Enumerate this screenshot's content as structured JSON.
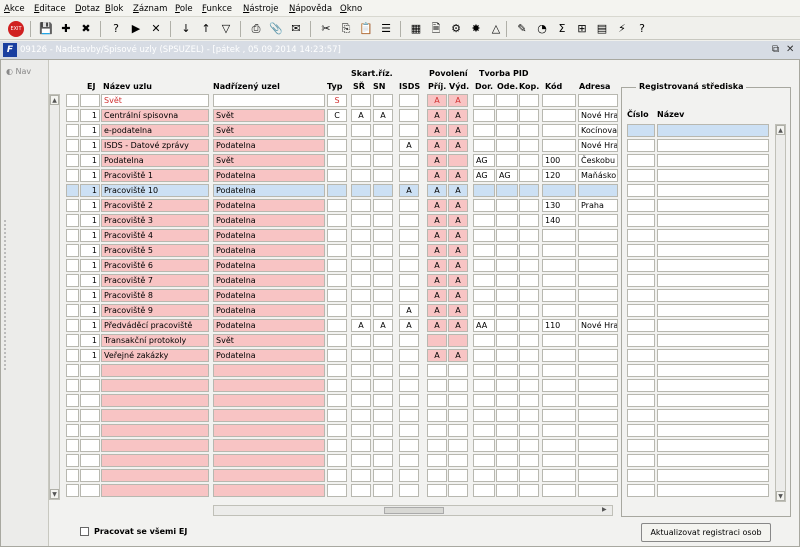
{
  "menu": [
    "Akce",
    "Editace",
    "Dotaz",
    "Blok",
    "Záznam",
    "Pole",
    "Funkce",
    "Nástroje",
    "Nápověda",
    "Okno"
  ],
  "toolbar": {
    "exit_label": "EXIT",
    "icons": [
      "exit-icon",
      "save-icon",
      "new-record-icon",
      "delete-record-icon",
      "enter-query-icon",
      "execute-query-icon",
      "cancel-query-icon",
      "sort-asc-icon",
      "sort-desc-icon",
      "filter-icon",
      "print-icon",
      "attach-icon",
      "mail-icon",
      "cut-icon",
      "copy-icon",
      "paste-icon",
      "list-icon",
      "calculator-icon",
      "document-icon",
      "gear-icon",
      "target-icon",
      "triangle-icon",
      "edit-icon",
      "globe-icon",
      "sum-icon",
      "excel-icon",
      "table-icon",
      "help-icon",
      "question-icon"
    ]
  },
  "window": {
    "title": "09126 - Nadstavby/Spisové uzly (SPSUZEL) - [pátek , 05.09.2014  14:23:57]",
    "restore": "⧉",
    "close": "✕"
  },
  "nav": {
    "label": "Nav"
  },
  "headers": {
    "ej": "EJ",
    "nazev": "Název uzlu",
    "nadrizeny": "Nadřízený uzel",
    "typ": "Typ",
    "skart": "Skart.říz.",
    "sr": "SŘ",
    "sn": "SN",
    "isds": "ISDS",
    "povoleni": "Povolení",
    "prij": "Příj.",
    "vyd": "Výd.",
    "tvorba": "Tvorba PID",
    "dor": "Dor.",
    "ode": "Ode.",
    "kop": "Kop.",
    "kod": "Kód",
    "adresa": "Adresa"
  },
  "rows": [
    {
      "ej": "",
      "nazev": "Svět",
      "nad": "",
      "typ": "S",
      "sr": "",
      "sn": "",
      "isds": "",
      "prij": "A",
      "vyd": "A",
      "dor": "",
      "ode": "",
      "kop": "",
      "kod": "",
      "adr": "",
      "style": "root"
    },
    {
      "ej": "1",
      "nazev": "Centrální spisovna",
      "nad": "Svět",
      "typ": "C",
      "sr": "A",
      "sn": "A",
      "isds": "",
      "prij": "A",
      "vyd": "A",
      "dor": "",
      "ode": "",
      "kop": "",
      "kod": "",
      "adr": "Nové Hra"
    },
    {
      "ej": "1",
      "nazev": "e-podatelna",
      "nad": "Svět",
      "typ": "",
      "sr": "",
      "sn": "",
      "isds": "",
      "prij": "A",
      "vyd": "A",
      "dor": "",
      "ode": "",
      "kop": "",
      "kod": "",
      "adr": "Kocínova"
    },
    {
      "ej": "1",
      "nazev": "ISDS - Datové zprávy",
      "nad": "Podatelna",
      "typ": "",
      "sr": "",
      "sn": "",
      "isds": "A",
      "prij": "A",
      "vyd": "A",
      "dor": "",
      "ode": "",
      "kop": "",
      "kod": "",
      "adr": "Nové Hra"
    },
    {
      "ej": "1",
      "nazev": "Podatelna",
      "nad": "Svět",
      "typ": "",
      "sr": "",
      "sn": "",
      "isds": "",
      "prij": "A",
      "vyd": "",
      "dor": "AG",
      "ode": "",
      "kop": "",
      "kod": "100",
      "adr": "Českobu"
    },
    {
      "ej": "1",
      "nazev": "Pracoviště 1",
      "nad": "Podatelna",
      "typ": "",
      "sr": "",
      "sn": "",
      "isds": "",
      "prij": "A",
      "vyd": "A",
      "dor": "AG",
      "ode": "AG",
      "kop": "",
      "kod": "120",
      "adr": "Maňásko"
    },
    {
      "ej": "1",
      "nazev": "Pracoviště 10",
      "nad": "Podatelna",
      "typ": "",
      "sr": "",
      "sn": "",
      "isds": "A",
      "prij": "A",
      "vyd": "A",
      "dor": "",
      "ode": "",
      "kop": "",
      "kod": "",
      "adr": "",
      "style": "selected"
    },
    {
      "ej": "1",
      "nazev": "Pracoviště 2",
      "nad": "Podatelna",
      "typ": "",
      "sr": "",
      "sn": "",
      "isds": "",
      "prij": "A",
      "vyd": "A",
      "dor": "",
      "ode": "",
      "kop": "",
      "kod": "130",
      "adr": "Praha"
    },
    {
      "ej": "1",
      "nazev": "Pracoviště 3",
      "nad": "Podatelna",
      "typ": "",
      "sr": "",
      "sn": "",
      "isds": "",
      "prij": "A",
      "vyd": "A",
      "dor": "",
      "ode": "",
      "kop": "",
      "kod": "140",
      "adr": ""
    },
    {
      "ej": "1",
      "nazev": "Pracoviště 4",
      "nad": "Podatelna",
      "typ": "",
      "sr": "",
      "sn": "",
      "isds": "",
      "prij": "A",
      "vyd": "A",
      "dor": "",
      "ode": "",
      "kop": "",
      "kod": "",
      "adr": ""
    },
    {
      "ej": "1",
      "nazev": "Pracoviště 5",
      "nad": "Podatelna",
      "typ": "",
      "sr": "",
      "sn": "",
      "isds": "",
      "prij": "A",
      "vyd": "A",
      "dor": "",
      "ode": "",
      "kop": "",
      "kod": "",
      "adr": ""
    },
    {
      "ej": "1",
      "nazev": "Pracoviště 6",
      "nad": "Podatelna",
      "typ": "",
      "sr": "",
      "sn": "",
      "isds": "",
      "prij": "A",
      "vyd": "A",
      "dor": "",
      "ode": "",
      "kop": "",
      "kod": "",
      "adr": ""
    },
    {
      "ej": "1",
      "nazev": "Pracoviště 7",
      "nad": "Podatelna",
      "typ": "",
      "sr": "",
      "sn": "",
      "isds": "",
      "prij": "A",
      "vyd": "A",
      "dor": "",
      "ode": "",
      "kop": "",
      "kod": "",
      "adr": ""
    },
    {
      "ej": "1",
      "nazev": "Pracoviště 8",
      "nad": "Podatelna",
      "typ": "",
      "sr": "",
      "sn": "",
      "isds": "",
      "prij": "A",
      "vyd": "A",
      "dor": "",
      "ode": "",
      "kop": "",
      "kod": "",
      "adr": ""
    },
    {
      "ej": "1",
      "nazev": "Pracoviště 9",
      "nad": "Podatelna",
      "typ": "",
      "sr": "",
      "sn": "",
      "isds": "A",
      "prij": "A",
      "vyd": "A",
      "dor": "",
      "ode": "",
      "kop": "",
      "kod": "",
      "adr": ""
    },
    {
      "ej": "1",
      "nazev": "Předváděcí pracoviště",
      "nad": "Podatelna",
      "typ": "",
      "sr": "A",
      "sn": "A",
      "isds": "A",
      "prij": "A",
      "vyd": "A",
      "dor": "AA",
      "ode": "",
      "kop": "",
      "kod": "110",
      "adr": "Nové Hra"
    },
    {
      "ej": "1",
      "nazev": "Transakční protokoly",
      "nad": "Svět",
      "typ": "",
      "sr": "",
      "sn": "",
      "isds": "",
      "prij": "",
      "vyd": "",
      "dor": "",
      "ode": "",
      "kop": "",
      "kod": "",
      "adr": ""
    },
    {
      "ej": "1",
      "nazev": "Veřejné zakázky",
      "nad": "Podatelna",
      "typ": "",
      "sr": "",
      "sn": "",
      "isds": "",
      "prij": "A",
      "vyd": "A",
      "dor": "",
      "ode": "",
      "kop": "",
      "kod": "",
      "adr": ""
    }
  ],
  "empty_rows": 9,
  "reg": {
    "title": "Registrovaná střediska",
    "cislo": "Číslo",
    "nazev": "Název",
    "rows": 25
  },
  "bottom": {
    "checkbox_label": "Pracovat se všemi EJ",
    "button_label": "Aktualizovat registraci osob"
  }
}
